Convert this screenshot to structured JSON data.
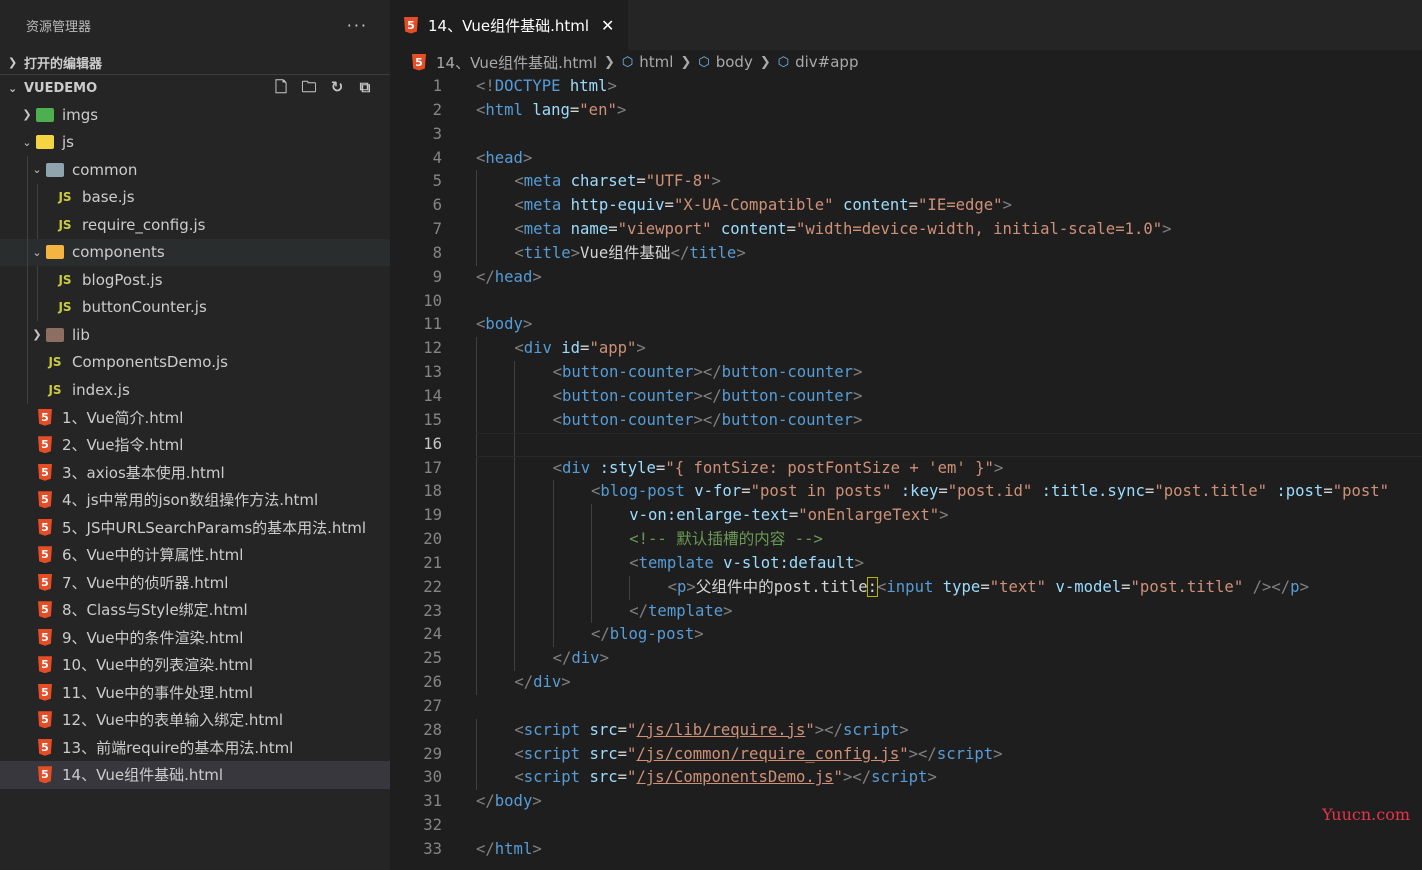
{
  "sidebar": {
    "title": "资源管理器",
    "more": "···",
    "open_editors": "打开的编辑器",
    "project": "VUEDEMO",
    "tools": [
      "new-file-icon",
      "new-folder-icon",
      "refresh-icon",
      "collapse-all-icon"
    ],
    "tree": [
      {
        "label": "imgs",
        "type": "folder",
        "depth": 1,
        "open": false,
        "color": "#4caf50"
      },
      {
        "label": "js",
        "type": "folder",
        "depth": 1,
        "open": true,
        "color": "#f5d442"
      },
      {
        "label": "common",
        "type": "folder",
        "depth": 2,
        "open": true,
        "color": "#90a4ae"
      },
      {
        "label": "base.js",
        "type": "js",
        "depth": 3
      },
      {
        "label": "require_config.js",
        "type": "js",
        "depth": 3
      },
      {
        "label": "components",
        "type": "folder",
        "depth": 2,
        "open": true,
        "color": "#f5b342",
        "hl": true
      },
      {
        "label": "blogPost.js",
        "type": "js",
        "depth": 3
      },
      {
        "label": "buttonCounter.js",
        "type": "js",
        "depth": 3
      },
      {
        "label": "lib",
        "type": "folder",
        "depth": 2,
        "open": false,
        "color": "#8d6e63"
      },
      {
        "label": "ComponentsDemo.js",
        "type": "js",
        "depth": 2
      },
      {
        "label": "index.js",
        "type": "js",
        "depth": 2
      },
      {
        "label": "1、Vue简介.html",
        "type": "html",
        "depth": 1
      },
      {
        "label": "2、Vue指令.html",
        "type": "html",
        "depth": 1
      },
      {
        "label": "3、axios基本使用.html",
        "type": "html",
        "depth": 1
      },
      {
        "label": "4、js中常用的json数组操作方法.html",
        "type": "html",
        "depth": 1
      },
      {
        "label": "5、JS中URLSearchParams的基本用法.html",
        "type": "html",
        "depth": 1
      },
      {
        "label": "6、Vue中的计算属性.html",
        "type": "html",
        "depth": 1
      },
      {
        "label": "7、Vue中的侦听器.html",
        "type": "html",
        "depth": 1
      },
      {
        "label": "8、Class与Style绑定.html",
        "type": "html",
        "depth": 1
      },
      {
        "label": "9、Vue中的条件渲染.html",
        "type": "html",
        "depth": 1
      },
      {
        "label": "10、Vue中的列表渲染.html",
        "type": "html",
        "depth": 1
      },
      {
        "label": "11、Vue中的事件处理.html",
        "type": "html",
        "depth": 1
      },
      {
        "label": "12、Vue中的表单输入绑定.html",
        "type": "html",
        "depth": 1
      },
      {
        "label": "13、前端require的基本用法.html",
        "type": "html",
        "depth": 1
      },
      {
        "label": "14、Vue组件基础.html",
        "type": "html",
        "depth": 1,
        "sel": true
      }
    ]
  },
  "editor": {
    "tab_label": "14、Vue组件基础.html",
    "close": "✕",
    "breadcrumb": [
      "14、Vue组件基础.html",
      "html",
      "body",
      "div#app"
    ],
    "current_line": 16,
    "lines": [
      {
        "n": "1",
        "i": 0,
        "s": [
          [
            "t",
            "<!"
          ],
          [
            "tg",
            "DOCTYPE"
          ],
          [
            "tx",
            " "
          ],
          [
            "at",
            "html"
          ],
          [
            "t",
            ">"
          ]
        ]
      },
      {
        "n": "2",
        "i": 0,
        "s": [
          [
            "t",
            "<"
          ],
          [
            "tg",
            "html"
          ],
          [
            "tx",
            " "
          ],
          [
            "at",
            "lang"
          ],
          [
            "tx",
            "="
          ],
          [
            "st",
            "\"en\""
          ],
          [
            "t",
            ">"
          ]
        ]
      },
      {
        "n": "3",
        "i": 0,
        "s": []
      },
      {
        "n": "4",
        "i": 0,
        "s": [
          [
            "t",
            "<"
          ],
          [
            "tg",
            "head"
          ],
          [
            "t",
            ">"
          ]
        ]
      },
      {
        "n": "5",
        "i": 1,
        "s": [
          [
            "t",
            "<"
          ],
          [
            "tg",
            "meta"
          ],
          [
            "tx",
            " "
          ],
          [
            "at",
            "charset"
          ],
          [
            "tx",
            "="
          ],
          [
            "st",
            "\"UTF-8\""
          ],
          [
            "t",
            ">"
          ]
        ]
      },
      {
        "n": "6",
        "i": 1,
        "s": [
          [
            "t",
            "<"
          ],
          [
            "tg",
            "meta"
          ],
          [
            "tx",
            " "
          ],
          [
            "at",
            "http-equiv"
          ],
          [
            "tx",
            "="
          ],
          [
            "st",
            "\"X-UA-Compatible\""
          ],
          [
            "tx",
            " "
          ],
          [
            "at",
            "content"
          ],
          [
            "tx",
            "="
          ],
          [
            "st",
            "\"IE=edge\""
          ],
          [
            "t",
            ">"
          ]
        ]
      },
      {
        "n": "7",
        "i": 1,
        "s": [
          [
            "t",
            "<"
          ],
          [
            "tg",
            "meta"
          ],
          [
            "tx",
            " "
          ],
          [
            "at",
            "name"
          ],
          [
            "tx",
            "="
          ],
          [
            "st",
            "\"viewport\""
          ],
          [
            "tx",
            " "
          ],
          [
            "at",
            "content"
          ],
          [
            "tx",
            "="
          ],
          [
            "st",
            "\"width=device-width, initial-scale=1.0\""
          ],
          [
            "t",
            ">"
          ]
        ]
      },
      {
        "n": "8",
        "i": 1,
        "s": [
          [
            "t",
            "<"
          ],
          [
            "tg",
            "title"
          ],
          [
            "t",
            ">"
          ],
          [
            "tx",
            "Vue组件基础"
          ],
          [
            "t",
            "</"
          ],
          [
            "tg",
            "title"
          ],
          [
            "t",
            ">"
          ]
        ]
      },
      {
        "n": "9",
        "i": 0,
        "s": [
          [
            "t",
            "</"
          ],
          [
            "tg",
            "head"
          ],
          [
            "t",
            ">"
          ]
        ]
      },
      {
        "n": "10",
        "i": 0,
        "s": []
      },
      {
        "n": "11",
        "i": 0,
        "s": [
          [
            "t",
            "<"
          ],
          [
            "tg",
            "body"
          ],
          [
            "t",
            ">"
          ]
        ]
      },
      {
        "n": "12",
        "i": 1,
        "s": [
          [
            "t",
            "<"
          ],
          [
            "tg",
            "div"
          ],
          [
            "tx",
            " "
          ],
          [
            "at",
            "id"
          ],
          [
            "tx",
            "="
          ],
          [
            "st",
            "\"app\""
          ],
          [
            "t",
            ">"
          ]
        ]
      },
      {
        "n": "13",
        "i": 2,
        "s": [
          [
            "t",
            "<"
          ],
          [
            "tg",
            "button-counter"
          ],
          [
            "t",
            "></"
          ],
          [
            "tg",
            "button-counter"
          ],
          [
            "t",
            ">"
          ]
        ]
      },
      {
        "n": "14",
        "i": 2,
        "s": [
          [
            "t",
            "<"
          ],
          [
            "tg",
            "button-counter"
          ],
          [
            "t",
            "></"
          ],
          [
            "tg",
            "button-counter"
          ],
          [
            "t",
            ">"
          ]
        ]
      },
      {
        "n": "15",
        "i": 2,
        "s": [
          [
            "t",
            "<"
          ],
          [
            "tg",
            "button-counter"
          ],
          [
            "t",
            "></"
          ],
          [
            "tg",
            "button-counter"
          ],
          [
            "t",
            ">"
          ]
        ]
      },
      {
        "n": "16",
        "i": 2,
        "s": []
      },
      {
        "n": "17",
        "i": 2,
        "s": [
          [
            "t",
            "<"
          ],
          [
            "tg",
            "div"
          ],
          [
            "tx",
            " "
          ],
          [
            "at",
            ":style"
          ],
          [
            "tx",
            "="
          ],
          [
            "st",
            "\"{ fontSize: postFontSize + 'em' }\""
          ],
          [
            "t",
            ">"
          ]
        ]
      },
      {
        "n": "18",
        "i": 3,
        "s": [
          [
            "t",
            "<"
          ],
          [
            "tg",
            "blog-post"
          ],
          [
            "tx",
            " "
          ],
          [
            "at",
            "v-for"
          ],
          [
            "tx",
            "="
          ],
          [
            "st",
            "\"post in posts\""
          ],
          [
            "tx",
            " "
          ],
          [
            "at",
            ":key"
          ],
          [
            "tx",
            "="
          ],
          [
            "st",
            "\"post.id\""
          ],
          [
            "tx",
            " "
          ],
          [
            "at",
            ":title.sync"
          ],
          [
            "tx",
            "="
          ],
          [
            "st",
            "\"post.title\""
          ],
          [
            "tx",
            " "
          ],
          [
            "at",
            ":post"
          ],
          [
            "tx",
            "="
          ],
          [
            "st",
            "\"post\""
          ]
        ]
      },
      {
        "n": "19",
        "i": 4,
        "s": [
          [
            "at",
            "v-on:enlarge-text"
          ],
          [
            "tx",
            "="
          ],
          [
            "st",
            "\"onEnlargeText\""
          ],
          [
            "t",
            ">"
          ]
        ]
      },
      {
        "n": "20",
        "i": 4,
        "s": [
          [
            "cm",
            "<!-- 默认插槽的内容 -->"
          ]
        ]
      },
      {
        "n": "21",
        "i": 4,
        "s": [
          [
            "t",
            "<"
          ],
          [
            "tg",
            "template"
          ],
          [
            "tx",
            " "
          ],
          [
            "at",
            "v-slot:default"
          ],
          [
            "t",
            ">"
          ]
        ]
      },
      {
        "n": "22",
        "i": 5,
        "s": [
          [
            "t",
            "<"
          ],
          [
            "tg",
            "p"
          ],
          [
            "t",
            ">"
          ],
          [
            "tx",
            "父组件中的post.title"
          ],
          [
            "bx",
            ":"
          ],
          [
            "t",
            "<"
          ],
          [
            "tg",
            "input"
          ],
          [
            "tx",
            " "
          ],
          [
            "at",
            "type"
          ],
          [
            "tx",
            "="
          ],
          [
            "st",
            "\"text\""
          ],
          [
            "tx",
            " "
          ],
          [
            "at",
            "v-model"
          ],
          [
            "tx",
            "="
          ],
          [
            "st",
            "\"post.title\""
          ],
          [
            "tx",
            " "
          ],
          [
            "t",
            "/></"
          ],
          [
            "tg",
            "p"
          ],
          [
            "t",
            ">"
          ]
        ]
      },
      {
        "n": "23",
        "i": 4,
        "s": [
          [
            "t",
            "</"
          ],
          [
            "tg",
            "template"
          ],
          [
            "t",
            ">"
          ]
        ]
      },
      {
        "n": "24",
        "i": 3,
        "s": [
          [
            "t",
            "</"
          ],
          [
            "tg",
            "blog-post"
          ],
          [
            "t",
            ">"
          ]
        ]
      },
      {
        "n": "25",
        "i": 2,
        "s": [
          [
            "t",
            "</"
          ],
          [
            "tg",
            "div"
          ],
          [
            "t",
            ">"
          ]
        ]
      },
      {
        "n": "26",
        "i": 1,
        "s": [
          [
            "t",
            "</"
          ],
          [
            "tg",
            "div"
          ],
          [
            "t",
            ">"
          ]
        ]
      },
      {
        "n": "27",
        "i": 0,
        "s": []
      },
      {
        "n": "28",
        "i": 1,
        "s": [
          [
            "t",
            "<"
          ],
          [
            "tg",
            "script"
          ],
          [
            "tx",
            " "
          ],
          [
            "at",
            "src"
          ],
          [
            "tx",
            "="
          ],
          [
            "st",
            "\""
          ],
          [
            "lk",
            "/js/lib/require.js"
          ],
          [
            "st",
            "\""
          ],
          [
            "t",
            "></"
          ],
          [
            "tg",
            "script"
          ],
          [
            "t",
            ">"
          ]
        ]
      },
      {
        "n": "29",
        "i": 1,
        "s": [
          [
            "t",
            "<"
          ],
          [
            "tg",
            "script"
          ],
          [
            "tx",
            " "
          ],
          [
            "at",
            "src"
          ],
          [
            "tx",
            "="
          ],
          [
            "st",
            "\""
          ],
          [
            "lk",
            "/js/common/require_config.js"
          ],
          [
            "st",
            "\""
          ],
          [
            "t",
            "></"
          ],
          [
            "tg",
            "script"
          ],
          [
            "t",
            ">"
          ]
        ]
      },
      {
        "n": "30",
        "i": 1,
        "s": [
          [
            "t",
            "<"
          ],
          [
            "tg",
            "script"
          ],
          [
            "tx",
            " "
          ],
          [
            "at",
            "src"
          ],
          [
            "tx",
            "="
          ],
          [
            "st",
            "\""
          ],
          [
            "lk",
            "/js/ComponentsDemo.js"
          ],
          [
            "st",
            "\""
          ],
          [
            "t",
            "></"
          ],
          [
            "tg",
            "script"
          ],
          [
            "t",
            ">"
          ]
        ]
      },
      {
        "n": "31",
        "i": 0,
        "s": [
          [
            "t",
            "</"
          ],
          [
            "tg",
            "body"
          ],
          [
            "t",
            ">"
          ]
        ]
      },
      {
        "n": "32",
        "i": 0,
        "s": []
      },
      {
        "n": "33",
        "i": 0,
        "s": [
          [
            "t",
            "</"
          ],
          [
            "tg",
            "html"
          ],
          [
            "t",
            ">"
          ]
        ]
      }
    ]
  },
  "watermark": "Yuucn.com"
}
